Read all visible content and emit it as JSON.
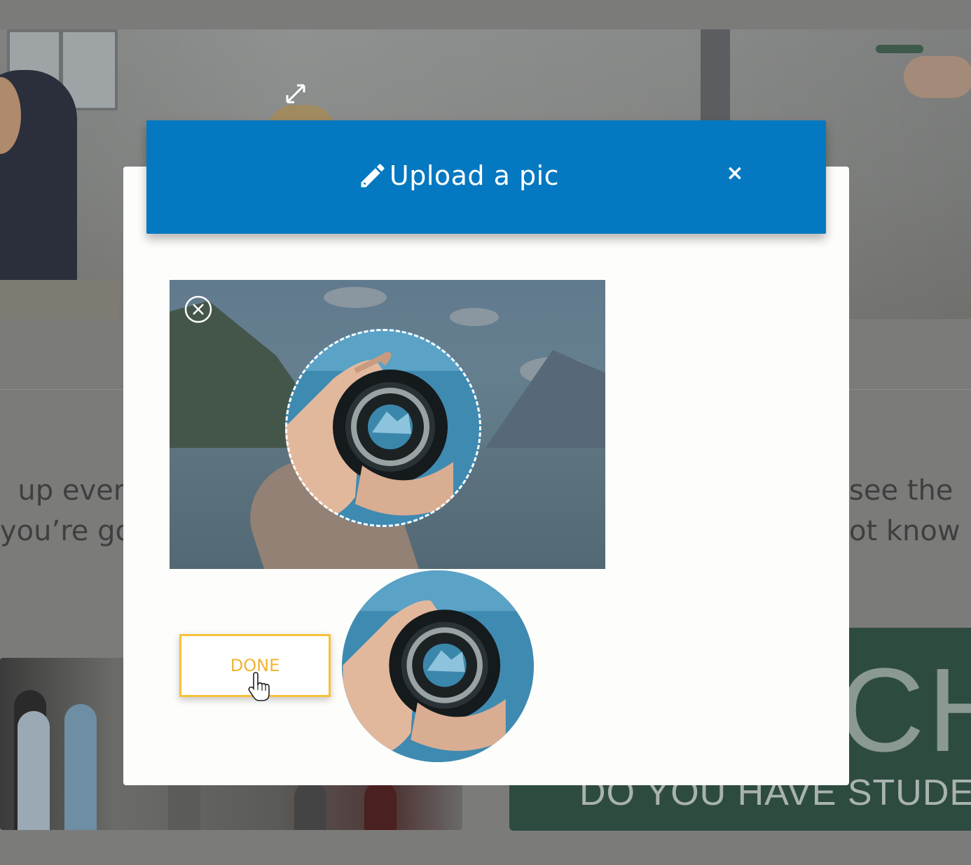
{
  "background": {
    "text_left": "  up ever\nyou’re go\n,",
    "text_right": "see the\not know",
    "banner_big_text": "CH",
    "banner_sub_text": "DO YOU HAVE STUDE"
  },
  "modal": {
    "title": "Upload a pic",
    "title_icon": "pencil-icon",
    "close_label": "×",
    "header_color": "#0478c1"
  },
  "cropper": {
    "remove_icon": "remove-image-icon",
    "resize_icon": "resize-handle-icon"
  },
  "actions": {
    "done_label": "DONE",
    "done_color": "#f1b431"
  }
}
